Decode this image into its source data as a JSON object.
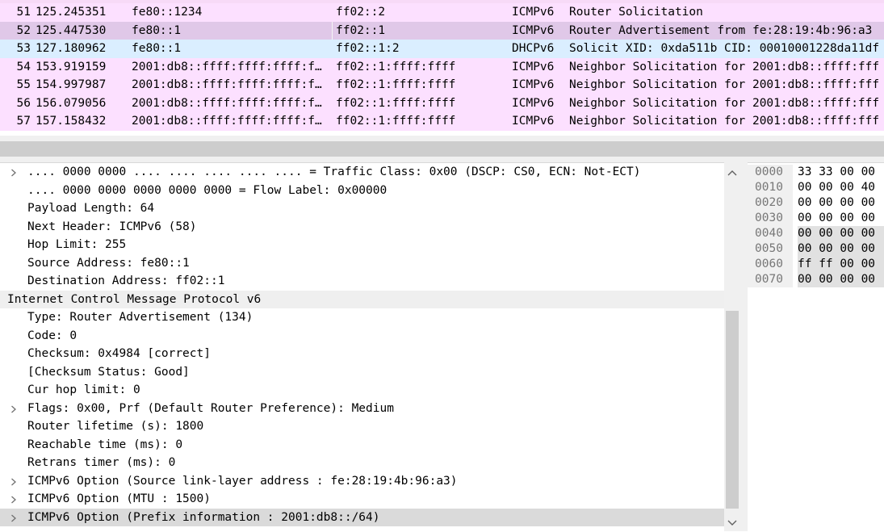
{
  "packets": [
    {
      "no": "51",
      "time": "125.245351",
      "source": "fe80::1234",
      "destination": "ff02::2",
      "protocol": "ICMPv6",
      "info": "Router Solicitation",
      "kind": "icmp"
    },
    {
      "no": "52",
      "time": "125.447530",
      "source": "fe80::1",
      "destination": "ff02::1",
      "protocol": "ICMPv6",
      "info": "Router Advertisement from fe:28:19:4b:96:a3",
      "kind": "selected"
    },
    {
      "no": "53",
      "time": "127.180962",
      "source": "fe80::1",
      "destination": "ff02::1:2",
      "protocol": "DHCPv6",
      "info": "Solicit XID: 0xda511b CID: 00010001228da11df",
      "kind": "dhcp"
    },
    {
      "no": "54",
      "time": "153.919159",
      "source": "2001:db8::ffff:ffff:ffff:f…",
      "destination": "ff02::1:ffff:ffff",
      "protocol": "ICMPv6",
      "info": "Neighbor Solicitation for 2001:db8::ffff:fff",
      "kind": "icmp"
    },
    {
      "no": "55",
      "time": "154.997987",
      "source": "2001:db8::ffff:ffff:ffff:f…",
      "destination": "ff02::1:ffff:ffff",
      "protocol": "ICMPv6",
      "info": "Neighbor Solicitation for 2001:db8::ffff:fff",
      "kind": "icmp"
    },
    {
      "no": "56",
      "time": "156.079056",
      "source": "2001:db8::ffff:ffff:ffff:f…",
      "destination": "ff02::1:ffff:ffff",
      "protocol": "ICMPv6",
      "info": "Neighbor Solicitation for 2001:db8::ffff:fff",
      "kind": "icmp"
    },
    {
      "no": "57",
      "time": "157.158432",
      "source": "2001:db8::ffff:ffff:ffff:f…",
      "destination": "ff02::1:ffff:ffff",
      "protocol": "ICMPv6",
      "info": "Neighbor Solicitation for 2001:db8::ffff:fff",
      "kind": "icmp"
    }
  ],
  "details": [
    {
      "text": ".... 0000 0000 .... .... .... .... .... = Traffic Class: 0x00 (DSCP: CS0, ECN: Not-ECT)",
      "expandable": true,
      "level": 1
    },
    {
      "text": ".... 0000 0000 0000 0000 0000 = Flow Label: 0x00000",
      "expandable": false,
      "level": 1
    },
    {
      "text": "Payload Length: 64",
      "expandable": false,
      "level": 1
    },
    {
      "text": "Next Header: ICMPv6 (58)",
      "expandable": false,
      "level": 1
    },
    {
      "text": "Hop Limit: 255",
      "expandable": false,
      "level": 1
    },
    {
      "text": "Source Address: fe80::1",
      "expandable": false,
      "level": 1
    },
    {
      "text": "Destination Address: ff02::1",
      "expandable": false,
      "level": 1
    },
    {
      "text": "Internet Control Message Protocol v6",
      "expandable": false,
      "level": 0,
      "header": true
    },
    {
      "text": "Type: Router Advertisement (134)",
      "expandable": false,
      "level": 1
    },
    {
      "text": "Code: 0",
      "expandable": false,
      "level": 1
    },
    {
      "text": "Checksum: 0x4984 [correct]",
      "expandable": false,
      "level": 1
    },
    {
      "text": "[Checksum Status: Good]",
      "expandable": false,
      "level": 1
    },
    {
      "text": "Cur hop limit: 0",
      "expandable": false,
      "level": 1
    },
    {
      "text": "Flags: 0x00, Prf (Default Router Preference): Medium",
      "expandable": true,
      "level": 1
    },
    {
      "text": "Router lifetime (s): 1800",
      "expandable": false,
      "level": 1
    },
    {
      "text": "Reachable time (ms): 0",
      "expandable": false,
      "level": 1
    },
    {
      "text": "Retrans timer (ms): 0",
      "expandable": false,
      "level": 1
    },
    {
      "text": "ICMPv6 Option (Source link-layer address : fe:28:19:4b:96:a3)",
      "expandable": true,
      "level": 1
    },
    {
      "text": "ICMPv6 Option (MTU : 1500)",
      "expandable": true,
      "level": 1
    },
    {
      "text": "ICMPv6 Option (Prefix information : 2001:db8::/64)",
      "expandable": true,
      "level": 1,
      "selected": true
    }
  ],
  "bytes": [
    {
      "offset": "0000",
      "hex": "33 33 00 00",
      "hl": false
    },
    {
      "offset": "0010",
      "hex": "00 00 00 40",
      "hl": false
    },
    {
      "offset": "0020",
      "hex": "00 00 00 00",
      "hl": false
    },
    {
      "offset": "0030",
      "hex": "00 00 00 00",
      "hl": false
    },
    {
      "offset": "0040",
      "hex": "00 00 00 00",
      "hl": true
    },
    {
      "offset": "0050",
      "hex": "00 00 00 00",
      "hl": true
    },
    {
      "offset": "0060",
      "hex": "ff ff 00 00",
      "hl": true
    },
    {
      "offset": "0070",
      "hex": "00 00 00 00",
      "hl": true
    }
  ],
  "icons": {
    "expander": "chevron-right-icon",
    "scroll_up": "chevron-up-icon",
    "scroll_down": "chevron-down-icon"
  },
  "colors": {
    "icmp_row": "#fce0ff",
    "dhcp_row": "#daeeff",
    "selected_row": "#e0c8e8"
  }
}
